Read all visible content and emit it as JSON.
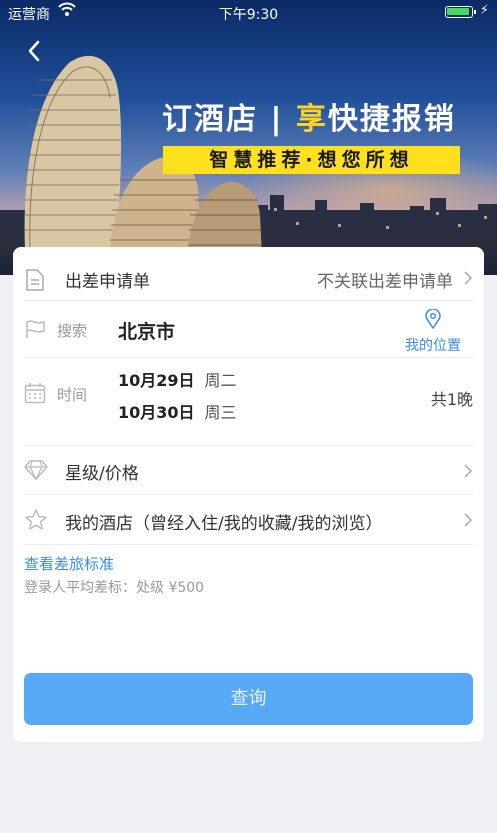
{
  "status_bar": {
    "carrier": "运营商",
    "time": "下午9:30"
  },
  "banner": {
    "slogan_main": "订酒店 | ",
    "slogan_highlight": "享",
    "slogan_rest": "快捷报销",
    "sub_slogan": "智慧推荐·想您所想"
  },
  "form": {
    "application": {
      "label": "出差申请单",
      "value": "不关联出差申请单"
    },
    "search": {
      "label": "搜索",
      "city": "北京市",
      "location_label": "我的位置"
    },
    "time": {
      "label": "时间",
      "checkin_date": "10月29日",
      "checkin_weekday": "周二",
      "checkout_date": "10月30日",
      "checkout_weekday": "周三",
      "nights": "共1晚"
    },
    "star_price": {
      "label": "星级/价格"
    },
    "my_hotels": {
      "label": "我的酒店（曾经入住/我的收藏/我的浏览）"
    },
    "policy_link": "查看差旅标准",
    "policy_info": "登录人平均差标：处级 ¥500",
    "query_button": "查询"
  },
  "colors": {
    "accent": "#3a8ee6",
    "button": "#57a8f5",
    "highlight": "#ffd322",
    "sub_slogan_bg": "#ffe01e"
  },
  "icons": [
    "back-icon",
    "wifi-icon",
    "battery-icon",
    "document-icon",
    "flag-icon",
    "location-pin-icon",
    "calendar-icon",
    "diamond-icon",
    "star-icon",
    "chevron-right-icon"
  ]
}
